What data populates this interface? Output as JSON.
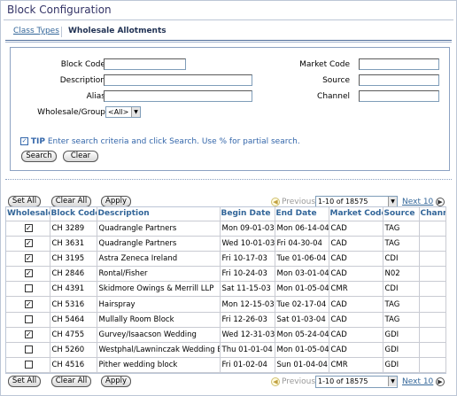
{
  "page": {
    "title": "Block Configuration"
  },
  "tabs": [
    {
      "label": "Class Types",
      "active": false
    },
    {
      "label": "Wholesale Allotments",
      "active": true
    }
  ],
  "search": {
    "block_code": {
      "label": "Block Code",
      "value": ""
    },
    "description": {
      "label": "Description",
      "value": ""
    },
    "alias": {
      "label": "Alias",
      "value": ""
    },
    "wholesale_group": {
      "label": "Wholesale/Group",
      "value": "<All>"
    },
    "market_code": {
      "label": "Market Code",
      "value": ""
    },
    "source": {
      "label": "Source",
      "value": ""
    },
    "channel": {
      "label": "Channel",
      "value": ""
    },
    "tip_label": "TIP",
    "tip_text": "Enter search criteria and click Search. Use % for partial search.",
    "search_button": "Search",
    "clear_button": "Clear"
  },
  "toolbar": {
    "set_all": "Set All",
    "clear_all": "Clear All",
    "apply": "Apply",
    "previous": "Previous",
    "range": "1-10 of 18575",
    "next": "Next 10"
  },
  "table": {
    "columns": [
      "Wholesale",
      "Block Code",
      "Description",
      "Begin Date",
      "End Date",
      "Market Code",
      "Source",
      "Channel"
    ],
    "rows": [
      {
        "checked": true,
        "block_code": "CH 3289",
        "description": "Quadrangle Partners",
        "begin": "Mon 09-01-03",
        "end": "Mon 06-14-04",
        "market": "CAD",
        "source": "TAG",
        "channel": ""
      },
      {
        "checked": true,
        "block_code": "CH 3631",
        "description": "Quadrangle Partners",
        "begin": "Wed 10-01-03",
        "end": "Fri 04-30-04",
        "market": "CAD",
        "source": "TAG",
        "channel": ""
      },
      {
        "checked": true,
        "block_code": "CH 3195",
        "description": "Astra Zeneca Ireland",
        "begin": "Fri 10-17-03",
        "end": "Tue 01-06-04",
        "market": "CAD",
        "source": "CDI",
        "channel": ""
      },
      {
        "checked": true,
        "block_code": "CH 2846",
        "description": "Rontal/Fisher",
        "begin": "Fri 10-24-03",
        "end": "Mon 03-01-04",
        "market": "CAD",
        "source": "N02",
        "channel": ""
      },
      {
        "checked": false,
        "block_code": "CH 4391",
        "description": "Skidmore Owings & Merrill LLP",
        "begin": "Sat 11-15-03",
        "end": "Mon 01-05-04",
        "market": "CMR",
        "source": "CDI",
        "channel": ""
      },
      {
        "checked": true,
        "block_code": "CH 5316",
        "description": "Hairspray",
        "begin": "Mon 12-15-03",
        "end": "Tue 02-17-04",
        "market": "CAD",
        "source": "TAG",
        "channel": ""
      },
      {
        "checked": false,
        "block_code": "CH 5464",
        "description": "Mullally Room Block",
        "begin": "Fri 12-26-03",
        "end": "Sat 01-03-04",
        "market": "CAD",
        "source": "TAG",
        "channel": ""
      },
      {
        "checked": true,
        "block_code": "CH 4755",
        "description": "Gurvey/Isaacson Wedding",
        "begin": "Wed 12-31-03",
        "end": "Mon 05-24-04",
        "market": "CAD",
        "source": "GDI",
        "channel": ""
      },
      {
        "checked": false,
        "block_code": "CH 5260",
        "description": "Westphal/Lawninczak Wedding Bl",
        "begin": "Thu 01-01-04",
        "end": "Mon 01-05-04",
        "market": "CAD",
        "source": "GDI",
        "channel": ""
      },
      {
        "checked": false,
        "block_code": "CH 4516",
        "description": "Pither wedding block",
        "begin": "Fri 01-02-04",
        "end": "Sun 01-04-04",
        "market": "CMR",
        "source": "GDI",
        "channel": ""
      }
    ]
  }
}
